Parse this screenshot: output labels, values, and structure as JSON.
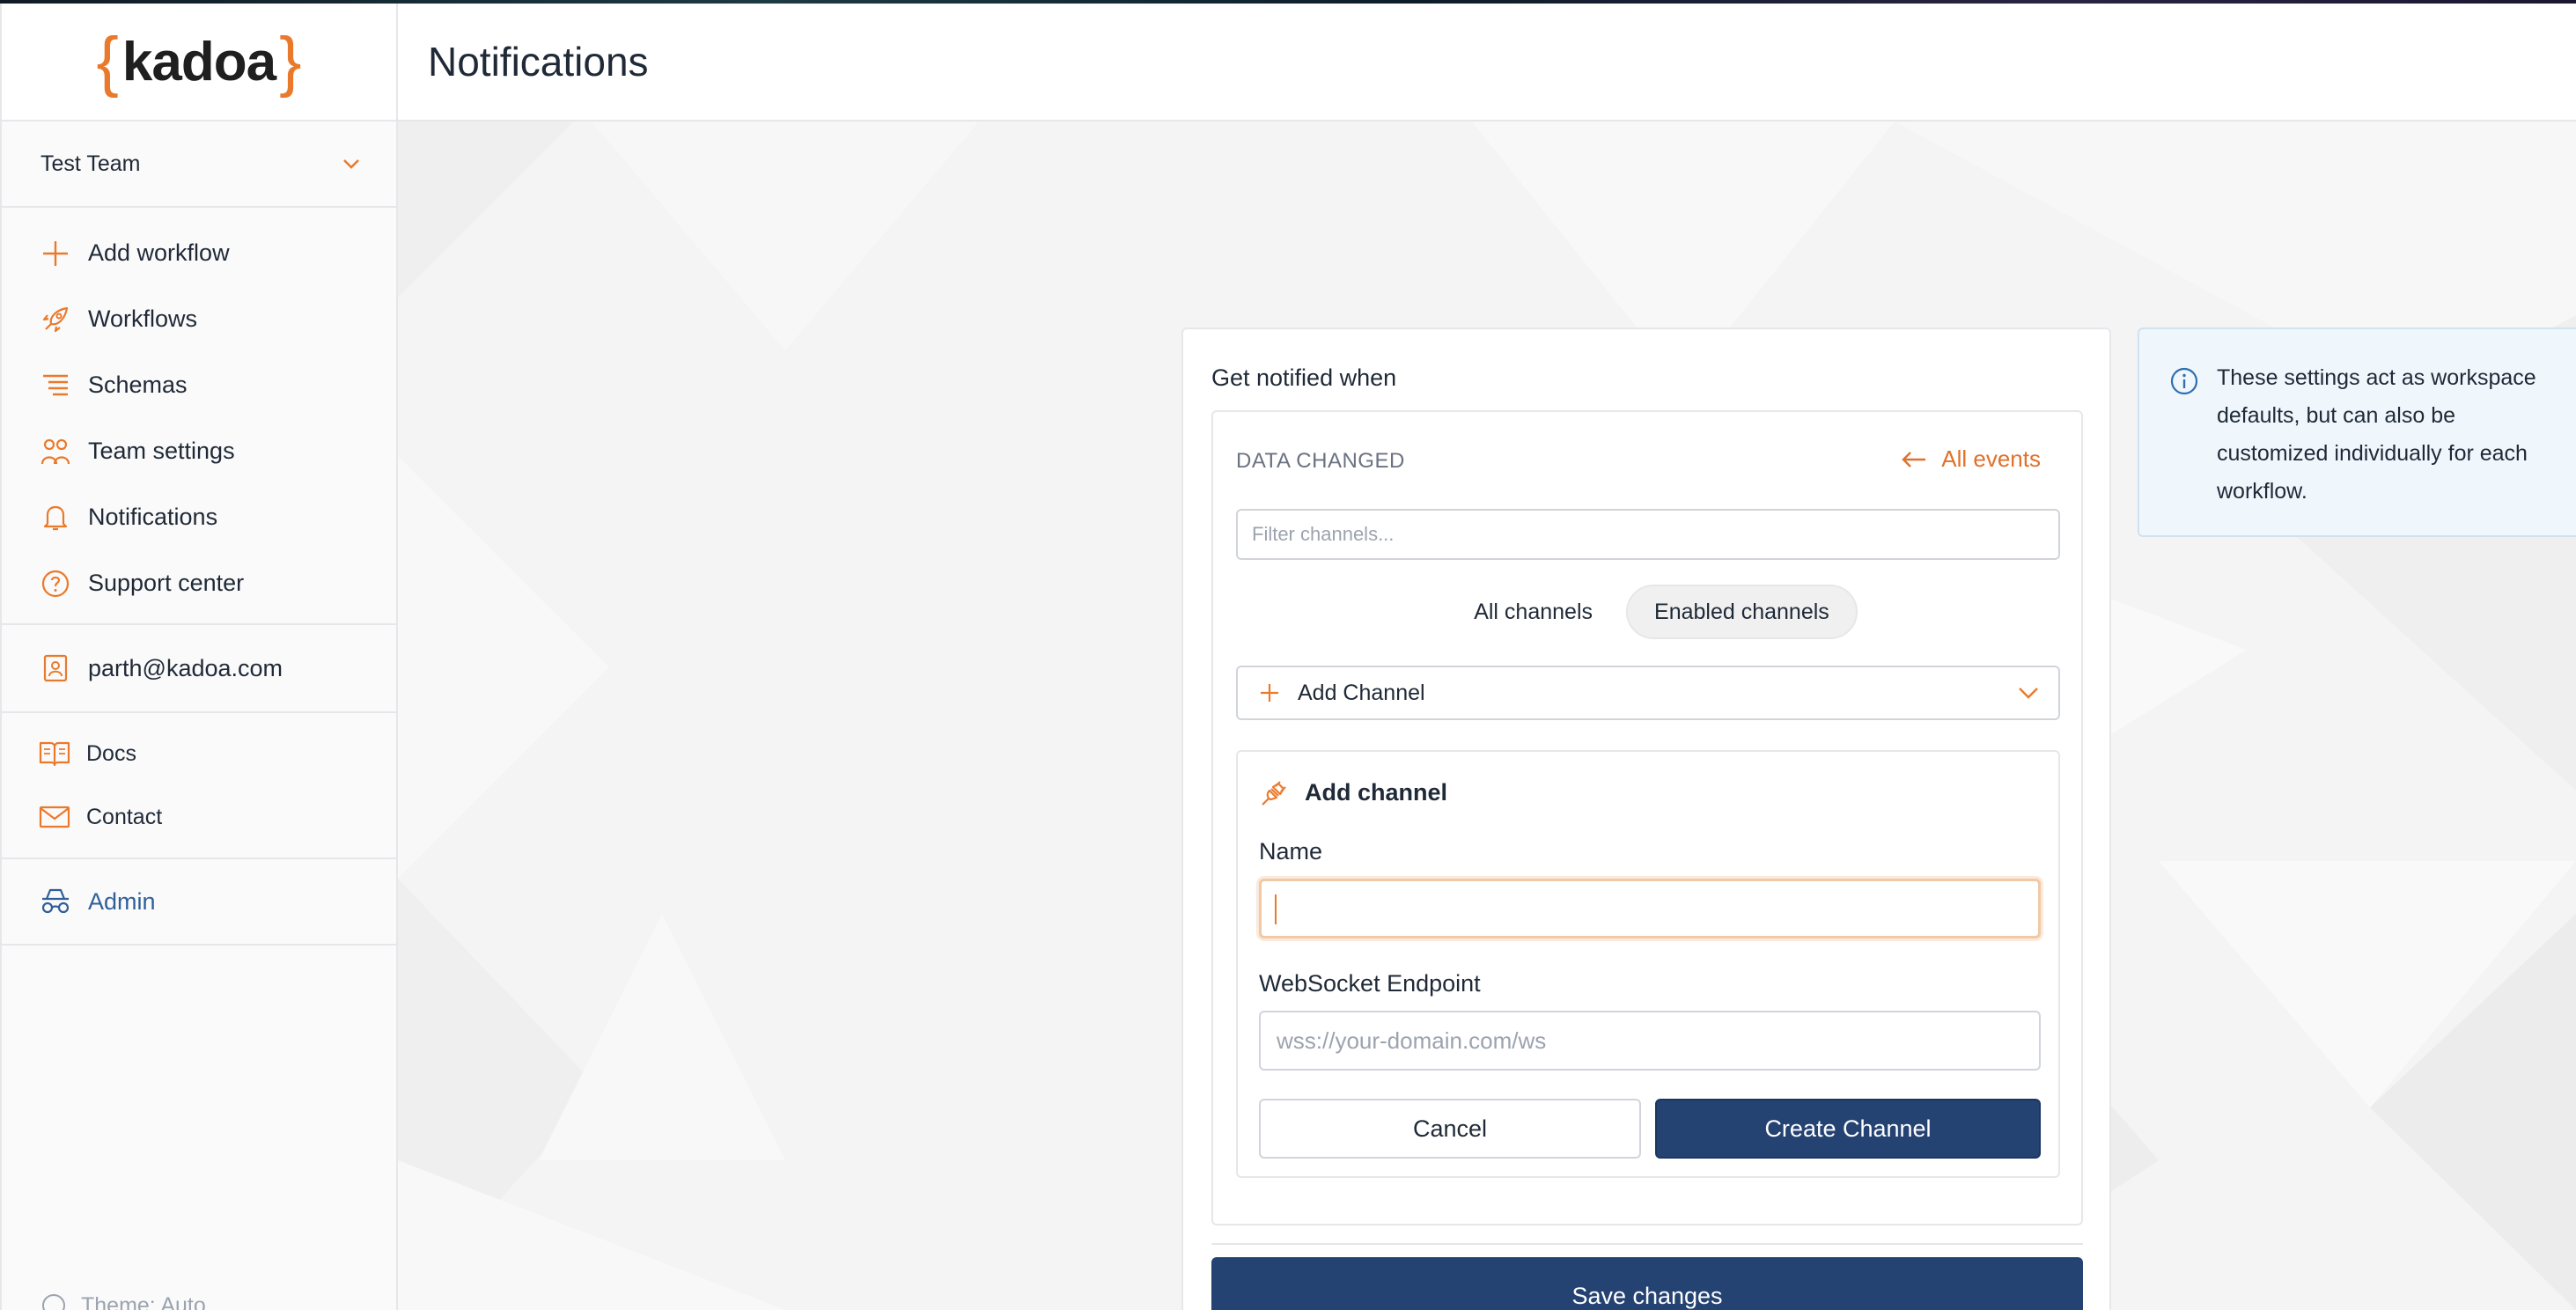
{
  "brand": {
    "open_brace": "{",
    "name": "kadoa",
    "close_brace": "}",
    "accent": "#ea7a2b"
  },
  "team": {
    "name": "Test Team"
  },
  "nav": [
    {
      "label": "Add workflow",
      "icon": "plus-icon"
    },
    {
      "label": "Workflows",
      "icon": "rocket-icon"
    },
    {
      "label": "Schemas",
      "icon": "schema-icon"
    },
    {
      "label": "Team settings",
      "icon": "team-icon"
    },
    {
      "label": "Notifications",
      "icon": "bell-icon"
    },
    {
      "label": "Support center",
      "icon": "help-icon"
    }
  ],
  "account": {
    "email": "parth@kadoa.com"
  },
  "links": [
    {
      "label": "Docs",
      "icon": "book-icon"
    },
    {
      "label": "Contact",
      "icon": "mail-icon"
    }
  ],
  "admin": {
    "label": "Admin",
    "color": "#2f5f99"
  },
  "theme": {
    "label": "Theme: Auto"
  },
  "header": {
    "title": "Notifications"
  },
  "card": {
    "title": "Get notified when",
    "event_heading": "DATA CHANGED",
    "all_events": "All events",
    "filter_placeholder": "Filter channels...",
    "tabs": [
      {
        "label": "All channels",
        "active": false
      },
      {
        "label": "Enabled channels",
        "active": true
      }
    ],
    "add_channel_select": "Add Channel",
    "form": {
      "title": "Add channel",
      "name_label": "Name",
      "name_value": "",
      "endpoint_label": "WebSocket Endpoint",
      "endpoint_placeholder": "wss://your-domain.com/ws",
      "cancel": "Cancel",
      "create": "Create Channel"
    },
    "save": "Save changes"
  },
  "info": {
    "text": "These settings act as workspace defaults, but can also be customized individually for each workflow."
  },
  "colors": {
    "primary": "#244272",
    "accent": "#e0712a",
    "info_bg": "#f0f7fc"
  }
}
